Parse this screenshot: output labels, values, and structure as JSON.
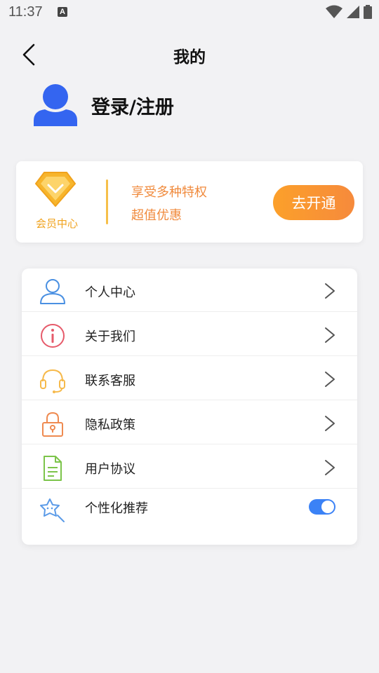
{
  "status_bar": {
    "time": "11:37",
    "notification_icon": "A",
    "icons": [
      "wifi-icon",
      "signal-icon",
      "battery-icon"
    ]
  },
  "nav": {
    "back_icon": "chevron-left-icon",
    "title": "我的"
  },
  "profile": {
    "avatar_icon": "user-avatar-icon",
    "login_text": "登录/注册"
  },
  "vip": {
    "icon": "diamond-icon",
    "label": "会员中心",
    "line1": "享受多种特权",
    "line2": "超值优惠",
    "button_label": "去开通",
    "colors": {
      "gold": "#f0a21c",
      "orange": "#f08a3c"
    }
  },
  "menu": {
    "items": [
      {
        "label": "个人中心",
        "icon": "user-outline-icon",
        "trailing": "chevron"
      },
      {
        "label": "关于我们",
        "icon": "info-icon",
        "trailing": "chevron"
      },
      {
        "label": "联系客服",
        "icon": "headset-icon",
        "trailing": "chevron"
      },
      {
        "label": "隐私政策",
        "icon": "lock-icon",
        "trailing": "chevron"
      },
      {
        "label": "用户协议",
        "icon": "document-icon",
        "trailing": "chevron"
      },
      {
        "label": "个性化推荐",
        "icon": "star-wand-icon",
        "trailing": "toggle",
        "toggle_on": true
      }
    ]
  },
  "colors": {
    "accent_blue": "#3b82f6",
    "background": "#f2f2f4"
  }
}
